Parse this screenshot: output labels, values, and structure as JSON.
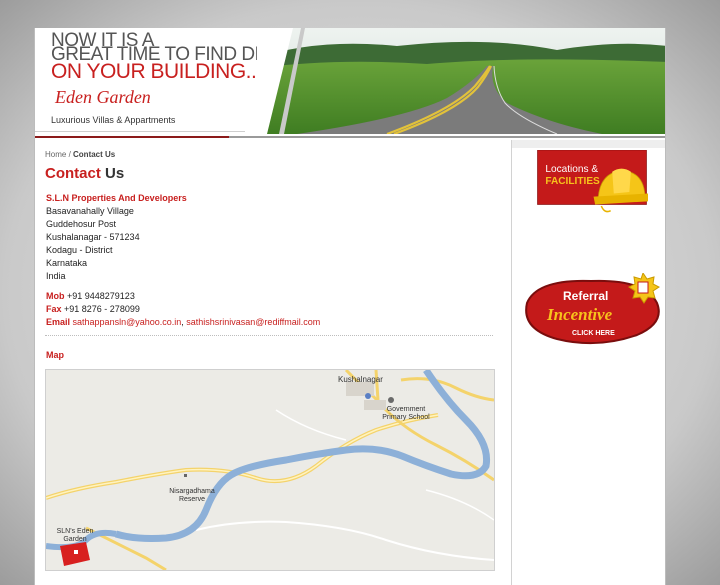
{
  "banner": {
    "line1": "NOW IT IS A",
    "line2": "GREAT TIME TO FIND DEALS",
    "line3": "ON YOUR BUILDING...",
    "brand": "Eden Garden",
    "tagline": "Luxurious Villas & Appartments"
  },
  "breadcrumb": {
    "home": "Home",
    "separator": " / ",
    "current": "Contact Us"
  },
  "page_title": {
    "highlight": "Contact",
    "rest": " Us"
  },
  "address": {
    "company": "S.L.N Properties And Developers",
    "lines": [
      "Basavanahally Village",
      "Guddehosur Post",
      "Kushalanagar - 571234",
      "Kodagu - District",
      "Karnataka",
      "India"
    ]
  },
  "contact": {
    "mob_label": "Mob",
    "mob_value": " +91 9448279123",
    "fax_label": "Fax",
    "fax_value": " +91 8276 - 278099",
    "email_label": "Email",
    "email1": "sathappansln@yahoo.co.in",
    "email_sep": ", ",
    "email2": "sathishsrinivasan@rediffmail.com"
  },
  "map": {
    "title": "Map",
    "labels": {
      "town": "Kushalnagar",
      "school": "Government Primary School",
      "reserve": "Nisargadhama Reserve",
      "site": "SLN's Eden Garden"
    }
  },
  "sidebar": {
    "locations_line1": "Locations &",
    "locations_line2": "FACILITIES",
    "referral_line1": "Referral",
    "referral_line2": "Incentive",
    "referral_cta": "CLICK HERE"
  },
  "colors": {
    "accent": "#c8201f",
    "dark_red": "#8b1a1a",
    "road": "#7b7b7b",
    "grass": "#5e9a2e"
  }
}
